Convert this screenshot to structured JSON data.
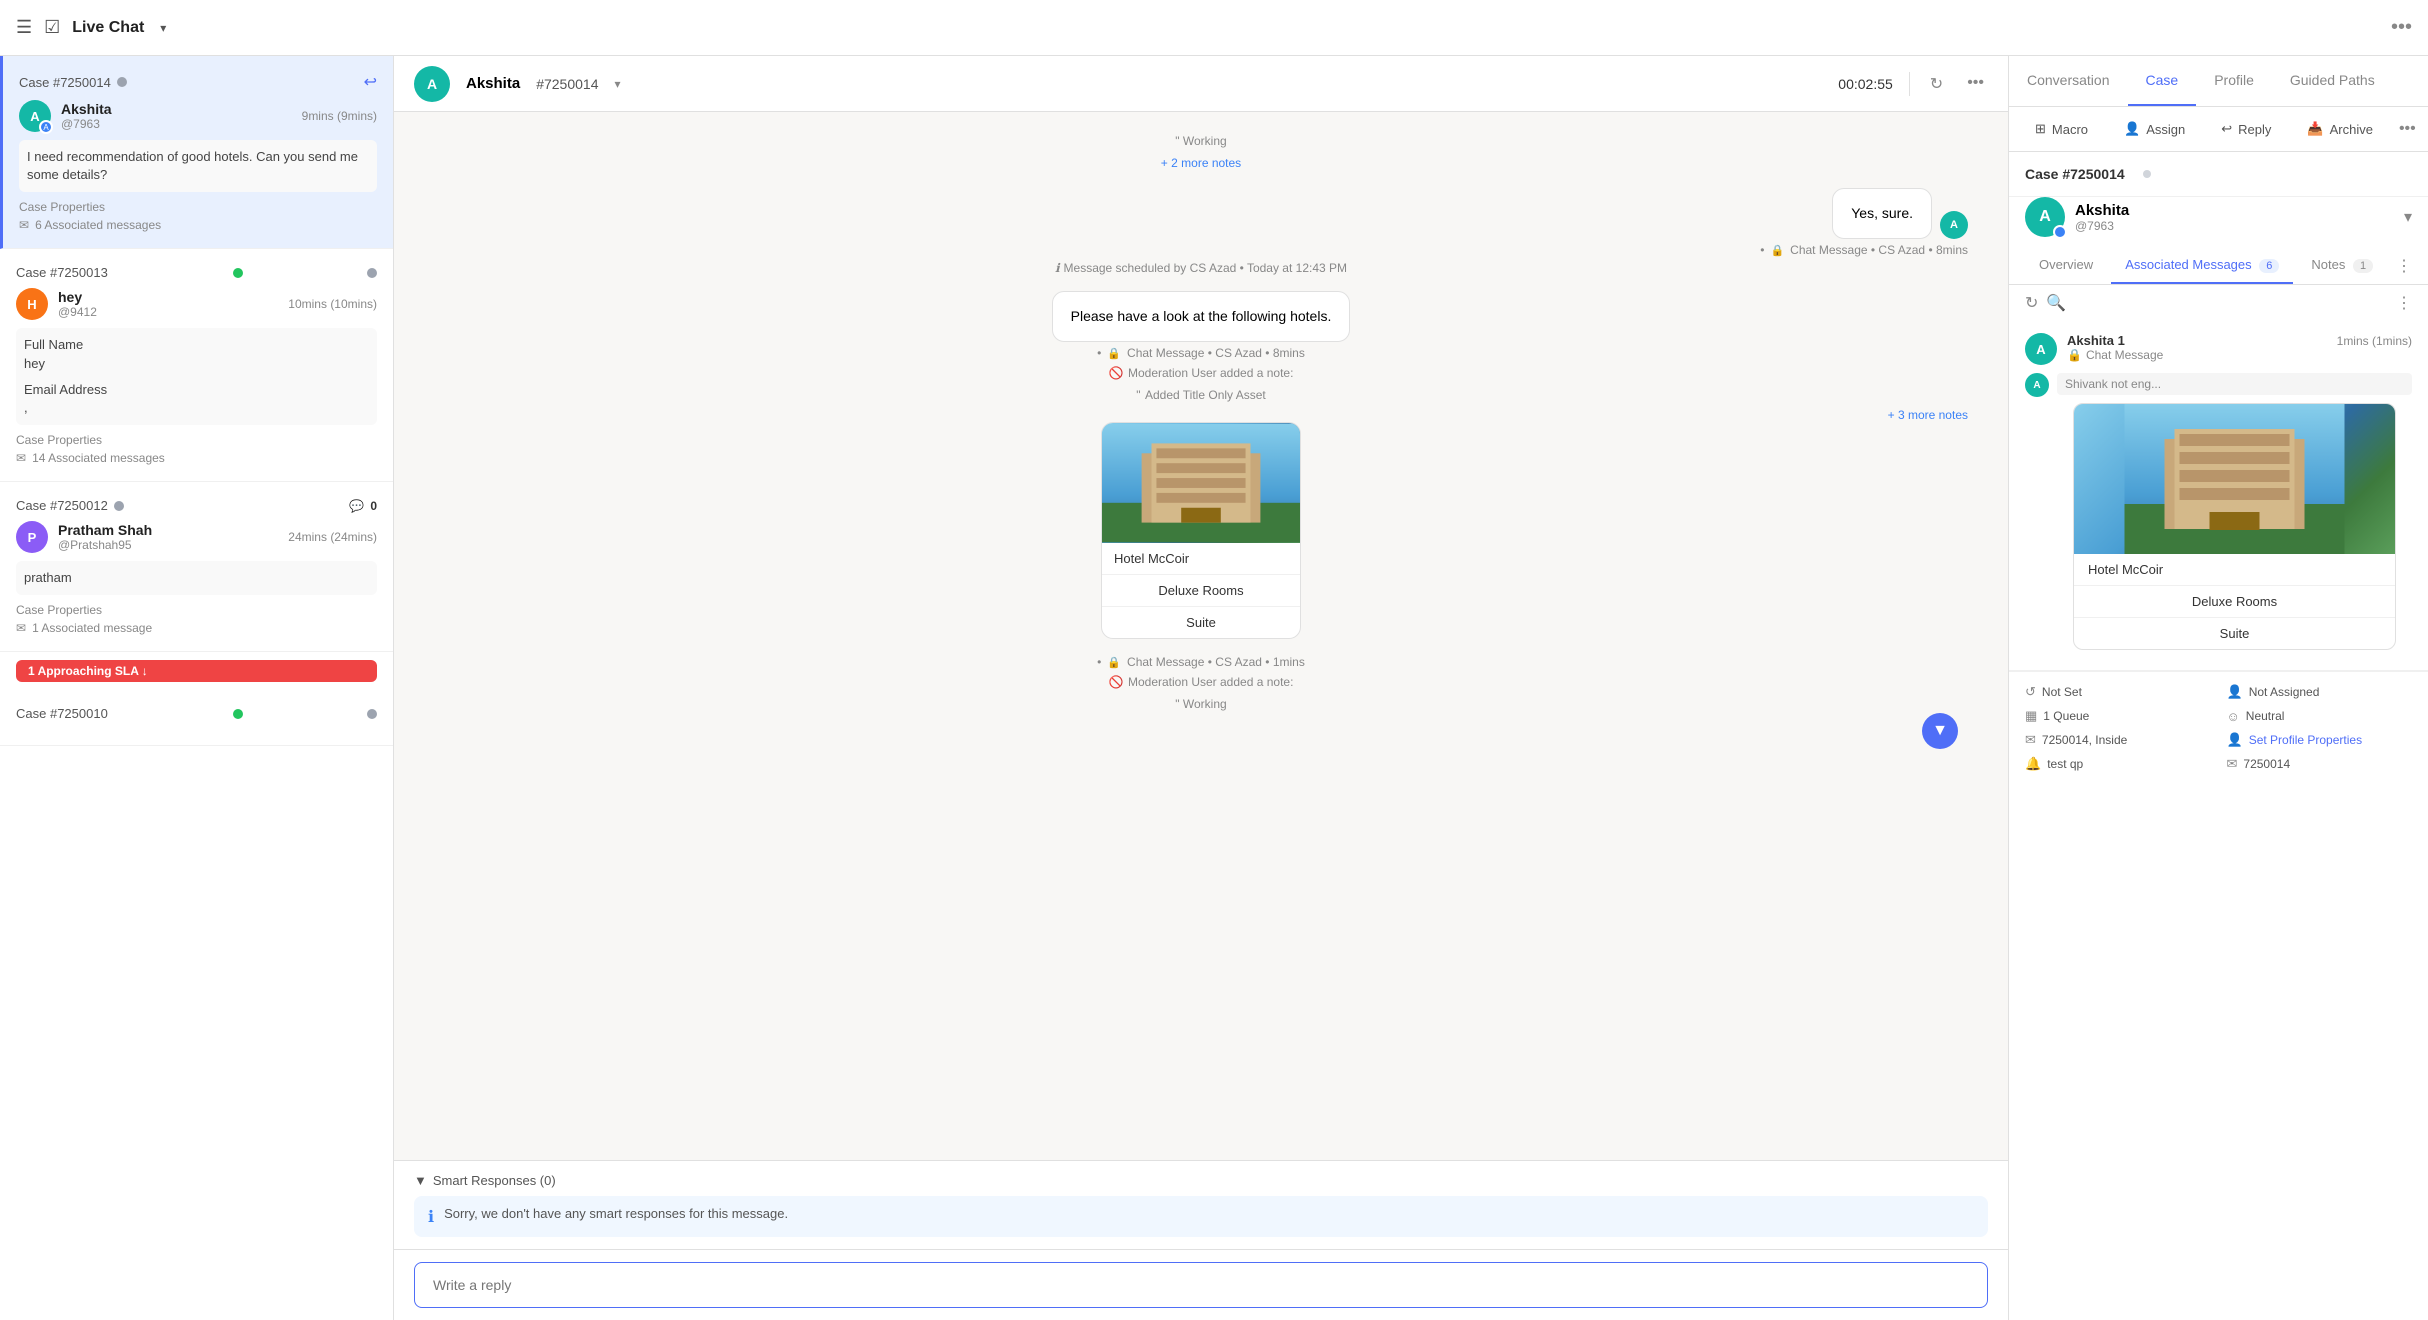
{
  "app": {
    "title": "Live Chat",
    "dropdown_icon": "▾"
  },
  "conv_list": {
    "items": [
      {
        "case_id": "Case #7250014",
        "status": "active",
        "username": "Akshita",
        "handle": "@7963",
        "time": "9mins (9mins)",
        "preview": "I need recommendation of good hotels. Can you send me some details?",
        "props_label": "Case Properties",
        "assoc_label": "6 Associated messages",
        "dot_color": "gray",
        "active": true
      },
      {
        "case_id": "Case #7250013",
        "status": "online",
        "username": "hey",
        "handle": "@9412",
        "time": "10mins (10mins)",
        "preview_lines": [
          "Full Name",
          "hey",
          "",
          "Email Address",
          ","
        ],
        "props_label": "Case Properties",
        "assoc_label": "14 Associated messages",
        "dot_color": "green",
        "active": false
      },
      {
        "case_id": "Case #7250012",
        "status": "offline",
        "username": "Pratham Shah",
        "handle": "@Pratshah95",
        "time": "24mins (24mins)",
        "preview": "pratham",
        "props_label": "Case Properties",
        "assoc_label": "1 Associated message",
        "dot_color": "gray",
        "badge": "0",
        "active": false
      },
      {
        "case_id": "Case #7250010",
        "status": "online",
        "dot_color": "green"
      }
    ],
    "sla_badge": "1 Approaching SLA ↓"
  },
  "chat": {
    "contact_name": "Akshita",
    "case_id": "#7250014",
    "timer": "00:02:55",
    "messages": [
      {
        "type": "note",
        "text": "Working",
        "extra": "+ 2 more notes"
      },
      {
        "type": "bubble_right",
        "text": "Yes, sure."
      },
      {
        "type": "meta",
        "lock": true,
        "text": "Chat Message • CS Azad • 8mins"
      },
      {
        "type": "scheduled",
        "text": "Message scheduled by CS Azad • Today at 12:43 PM"
      },
      {
        "type": "bubble_center",
        "text": "Please have a look at the following hotels."
      },
      {
        "type": "meta",
        "lock": true,
        "text": "Chat Message • CS Azad • 8mins"
      },
      {
        "type": "note_mod",
        "text": "Moderation User added a note:",
        "sub": "Added Title Only Asset"
      },
      {
        "type": "more_notes",
        "text": "+ 3 more notes"
      },
      {
        "type": "hotel_card",
        "name": "Hotel McCoir",
        "btn1": "Deluxe Rooms",
        "btn2": "Suite"
      },
      {
        "type": "meta",
        "lock": true,
        "text": "Chat Message • CS Azad • 1mins"
      },
      {
        "type": "note_mod",
        "text": "Moderation User added a note:",
        "sub": "Working"
      }
    ],
    "smart_responses": {
      "title": "Smart Responses (0)",
      "message": "Sorry, we don't have any smart responses for this message."
    },
    "reply_placeholder": "Write a reply"
  },
  "right_panel": {
    "tabs": [
      "Conversation",
      "Case",
      "Profile",
      "Guided Paths"
    ],
    "active_tab": "Case",
    "actions": [
      "Macro",
      "Assign",
      "Reply",
      "Archive"
    ],
    "case_id": "Case #7250014",
    "contact": {
      "name": "Akshita",
      "handle": "@7963"
    },
    "inner_tabs": {
      "overview": "Overview",
      "assoc_messages": "Associated Messages",
      "assoc_count": "6",
      "notes": "Notes",
      "notes_count": "1"
    },
    "assoc_message": {
      "user": "Akshita 1",
      "time": "1mins (1mins)",
      "type": "Chat Message",
      "preview": "Shivank not eng...",
      "hotel": {
        "name": "Hotel McCoir",
        "btn1": "Deluxe Rooms",
        "btn2": "Suite"
      }
    },
    "properties": [
      {
        "icon": "↺",
        "label": "Not Set"
      },
      {
        "icon": "👤",
        "label": "Not Assigned"
      },
      {
        "icon": "▦",
        "label": "1 Queue"
      },
      {
        "icon": "☺",
        "label": "Neutral"
      },
      {
        "icon": "✉",
        "label": "7250014, Inside"
      },
      {
        "icon": "👤",
        "label": "Set Profile Properties"
      },
      {
        "icon": "🔔",
        "label": "test qp"
      },
      {
        "icon": "✉",
        "label": "7250014"
      }
    ]
  }
}
